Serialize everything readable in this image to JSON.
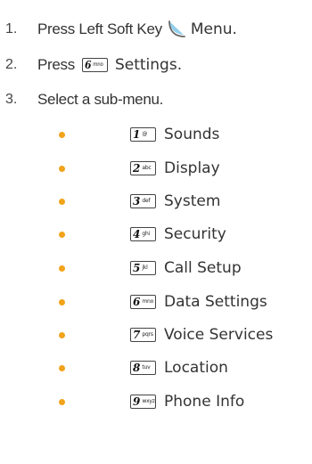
{
  "steps": [
    {
      "number": "1.",
      "before": "Press Left Soft Key",
      "icon": "left-soft-key-icon",
      "after": "Menu."
    },
    {
      "number": "2.",
      "before": "Press",
      "key": {
        "digit": "6",
        "letters": "mno"
      },
      "after": "Settings."
    },
    {
      "number": "3.",
      "before": "Select a sub-menu."
    }
  ],
  "submenu": [
    {
      "digit": "1",
      "letters": "@",
      "label": "Sounds"
    },
    {
      "digit": "2",
      "letters": "abc",
      "label": "Display"
    },
    {
      "digit": "3",
      "letters": "def",
      "label": "System"
    },
    {
      "digit": "4",
      "letters": "ghi",
      "label": "Security"
    },
    {
      "digit": "5",
      "letters": "jkl",
      "label": "Call Setup"
    },
    {
      "digit": "6",
      "letters": "mno",
      "label": "Data Settings"
    },
    {
      "digit": "7",
      "letters": "pqrs",
      "label": "Voice Services"
    },
    {
      "digit": "8",
      "letters": "tuv",
      "label": "Location"
    },
    {
      "digit": "9",
      "letters": "wxyz",
      "label": "Phone Info"
    }
  ],
  "colors": {
    "bullet": "#f2a31b",
    "text": "#333333"
  }
}
